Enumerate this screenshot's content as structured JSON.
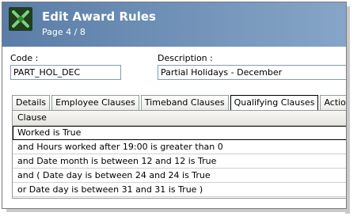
{
  "window": {
    "title": "Edit Award Rules",
    "page": "Page 4 / 8",
    "icon": "award-rules-app-icon"
  },
  "form": {
    "code_label": "Code :",
    "code_value": "PART_HOL_DEC",
    "description_label": "Description :",
    "description_value": "Partial Holidays - December"
  },
  "tabs": [
    {
      "label": "Details",
      "active": false
    },
    {
      "label": "Employee Clauses",
      "active": false
    },
    {
      "label": "Timeband Clauses",
      "active": false
    },
    {
      "label": "Qualifying Clauses",
      "active": true
    },
    {
      "label": "Action Clauses",
      "active": false
    }
  ],
  "clauses": {
    "header": "Clause",
    "rows": [
      "Worked is True",
      "and Hours worked after 19:00 is greater than 0",
      "and Date month is between 12 and  12 is True",
      "and ( Date day is between 24 and 24 is True",
      "or Date day is between 31 and  31 is True )"
    ]
  },
  "colors": {
    "titlebar_start": "#5a7da7",
    "titlebar_end": "#86a5c7",
    "icon_green": "#2e8b2e"
  }
}
